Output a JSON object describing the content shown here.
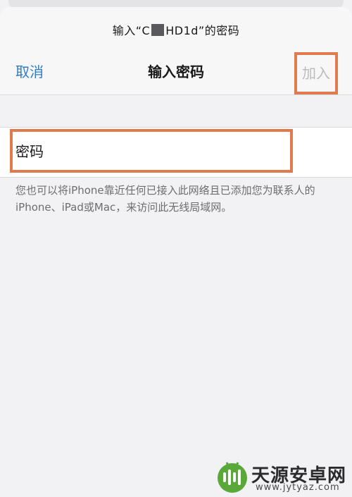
{
  "header": {
    "prompt_prefix": "输入“C",
    "prompt_suffix": "HD1d”的密码",
    "cancel_label": "取消",
    "title": "输入密码",
    "join_label": "加入"
  },
  "form": {
    "password_placeholder": "密码",
    "password_value": ""
  },
  "hint_text": "您也可以将iPhone靠近任何已接入此网络且已添加您为联系人的iPhone、iPad或Mac，来访问此无线局域网。",
  "watermark": {
    "title": "天源安卓网",
    "url": "www.jytyaz.com"
  },
  "colors": {
    "accent": "#2f7bc6",
    "highlight": "#e07a4f",
    "disabled": "#bcbcbc",
    "watermark_green": "#5aa83a"
  }
}
